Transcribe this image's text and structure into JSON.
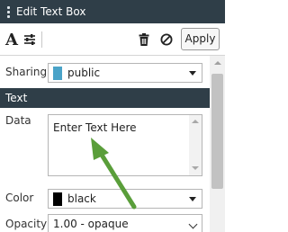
{
  "window": {
    "title": "Edit Text Box"
  },
  "toolbar": {
    "font_icon": "font-icon",
    "settings_icon": "sliders-icon",
    "delete_icon": "trash-icon",
    "remove_icon": "ban-icon",
    "apply_label": "Apply"
  },
  "sharing": {
    "label": "Sharing",
    "value": "public",
    "swatch_color": "#4aa3c8"
  },
  "text_section": {
    "header": "Text"
  },
  "data_field": {
    "label": "Data",
    "value": "Enter Text Here"
  },
  "color_field": {
    "label": "Color",
    "value": "black",
    "swatch_color": "#000000"
  },
  "opacity_field": {
    "label": "Opacity",
    "value": "1.00 - opaque"
  },
  "annotation": {
    "arrow_color": "#5a9e3a"
  }
}
